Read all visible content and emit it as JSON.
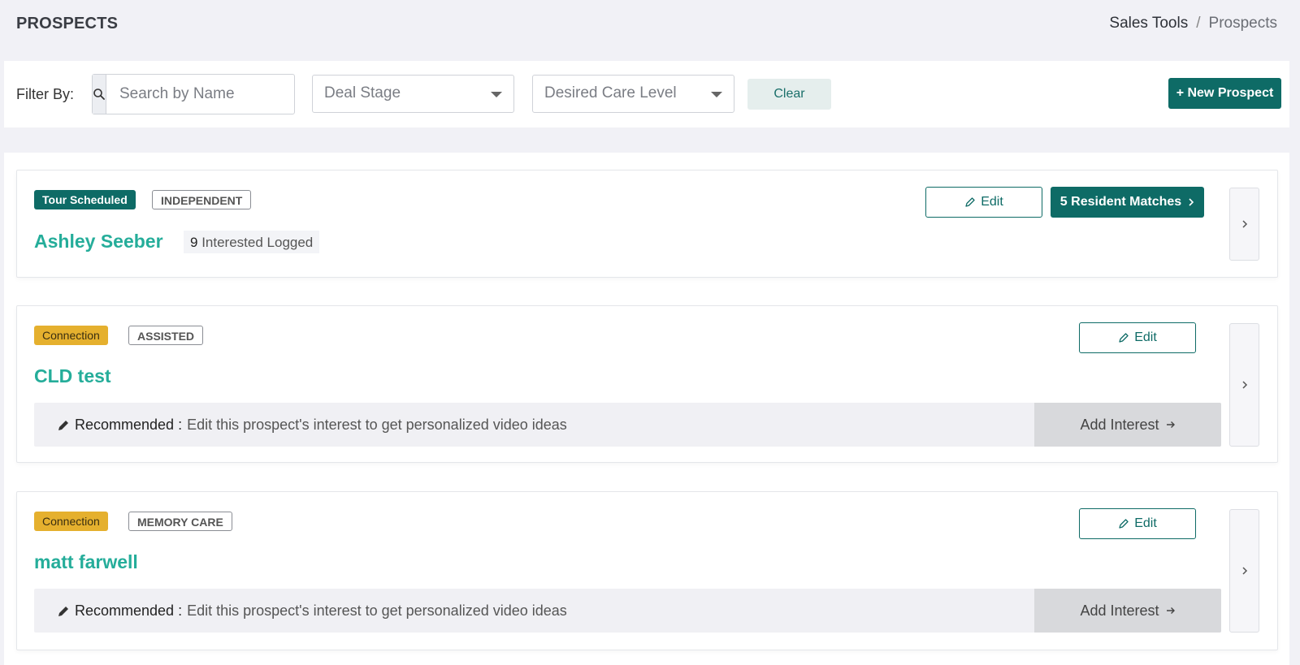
{
  "header": {
    "title": "PROSPECTS",
    "breadcrumb": [
      "Sales Tools",
      "Prospects"
    ],
    "breadcrumb_separator": "/"
  },
  "filters": {
    "label": "Filter By:",
    "search_placeholder": "Search by Name",
    "search_value": "",
    "deal_stage_placeholder": "Deal Stage",
    "care_level_placeholder": "Desired Care Level",
    "clear_label": "Clear",
    "new_prospect_label": "+ New Prospect"
  },
  "colors": {
    "primary": "#0e6b66",
    "name_teal": "#25ad9a",
    "stage_yellow": "#e5b02e"
  },
  "prospects": [
    {
      "stage": "Tour Scheduled",
      "care_level": "INDEPENDENT",
      "name": "Ashley Seeber",
      "interested_count": "9",
      "interested_label": "Interested Logged",
      "edit_label": "Edit",
      "matches_label": "5 Resident Matches"
    },
    {
      "stage": "Connection",
      "care_level": "ASSISTED",
      "name": "CLD test",
      "edit_label": "Edit",
      "recommended_label": "Recommended :",
      "recommended_text": "Edit this prospect's interest to get personalized video ideas",
      "add_interest_label": "Add Interest"
    },
    {
      "stage": "Connection",
      "care_level": "MEMORY CARE",
      "name": "matt farwell",
      "edit_label": "Edit",
      "recommended_label": "Recommended :",
      "recommended_text": "Edit this prospect's interest to get personalized video ideas",
      "add_interest_label": "Add Interest"
    }
  ]
}
